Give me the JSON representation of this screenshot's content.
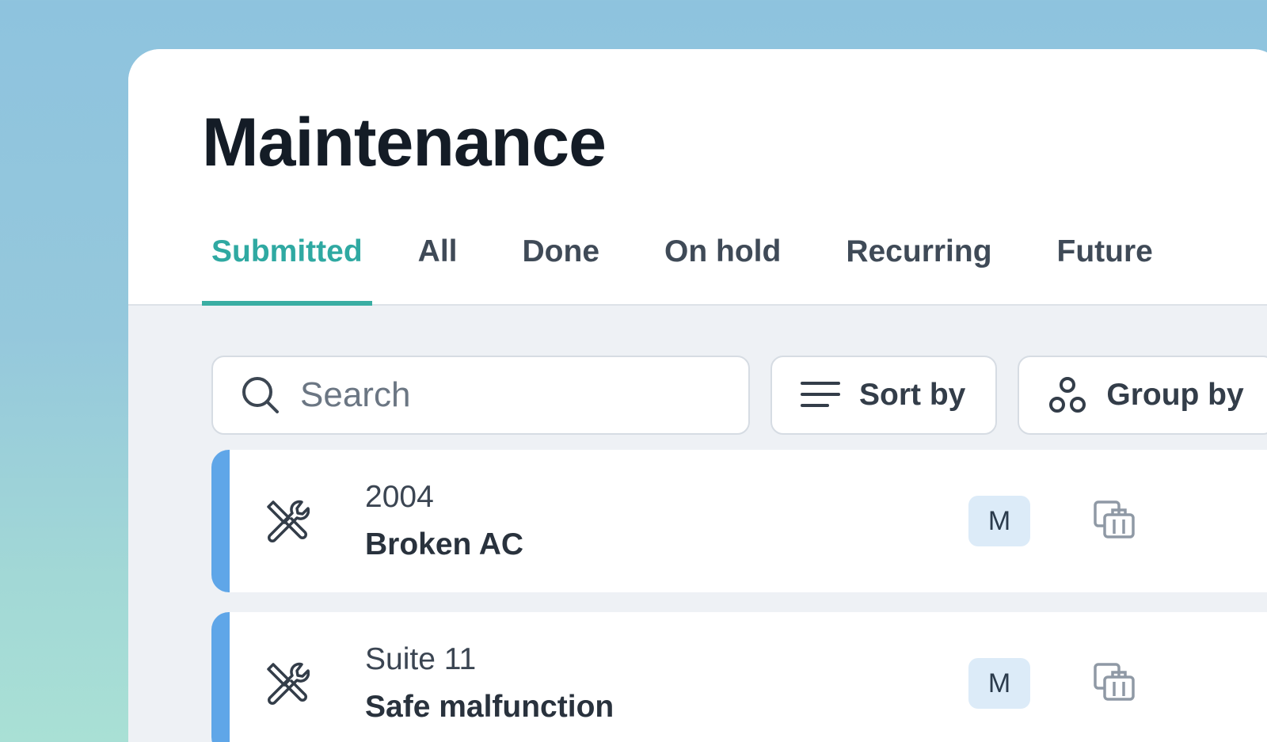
{
  "page": {
    "title": "Maintenance"
  },
  "tabs": [
    {
      "label": "Submitted",
      "active": true
    },
    {
      "label": "All",
      "active": false
    },
    {
      "label": "Done",
      "active": false
    },
    {
      "label": "On hold",
      "active": false
    },
    {
      "label": "Recurring",
      "active": false
    },
    {
      "label": "Future",
      "active": false
    }
  ],
  "toolbar": {
    "search_placeholder": "Search",
    "search_value": "",
    "sort_label": "Sort by",
    "group_label": "Group by"
  },
  "requests": [
    {
      "unit": "2004",
      "title": "Broken AC",
      "assignee": "M",
      "icon": "tools-icon",
      "action_icon": "copy-to-building-icon"
    },
    {
      "unit": "Suite 11",
      "title": "Safe malfunction",
      "assignee": "M",
      "icon": "tools-icon",
      "action_icon": "copy-to-building-icon"
    }
  ],
  "colors": {
    "accent": "#3aaea3",
    "row_stripe": "#5fa6e8",
    "avatar_bg": "#dcebf8",
    "title_text": "#141c26"
  },
  "icons": {
    "search": "search-icon",
    "sort": "sort-lines-icon",
    "group": "group-circles-icon"
  }
}
